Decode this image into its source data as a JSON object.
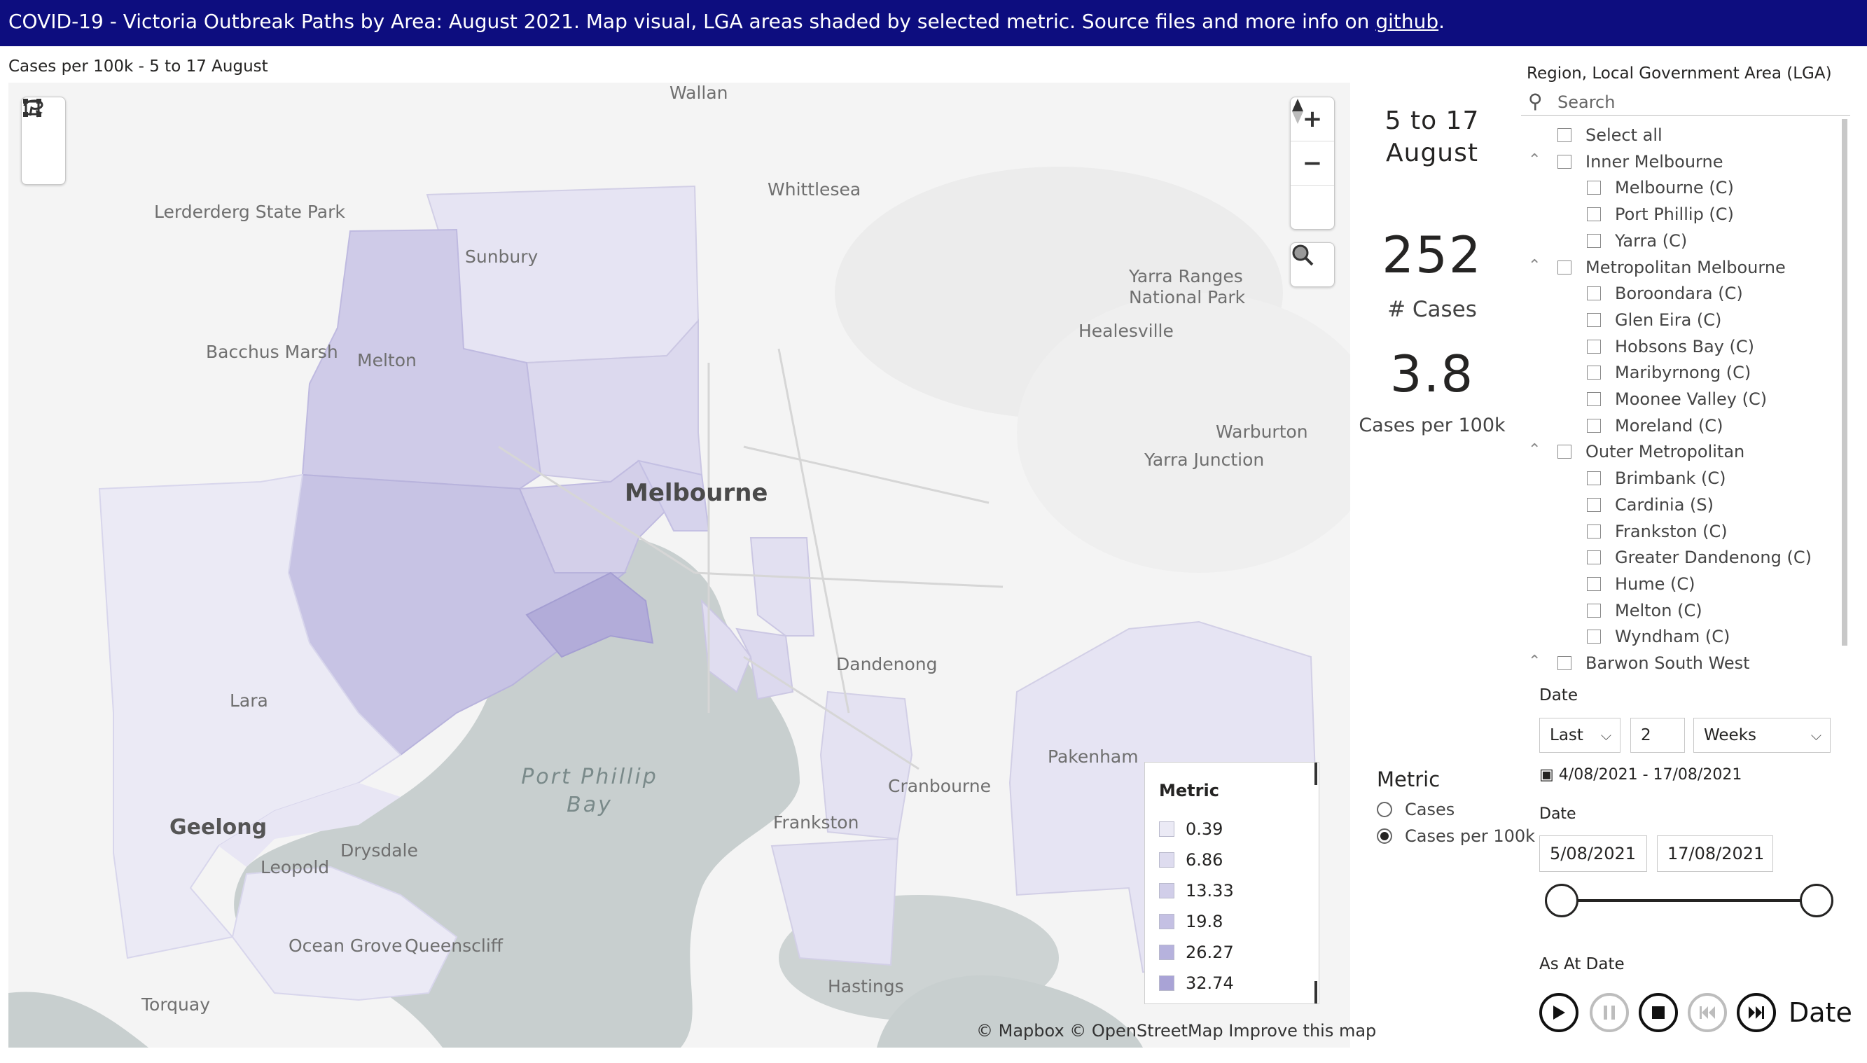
{
  "header": {
    "title_prefix": "COVID-19  - Victoria Outbreak Paths by Area: August 2021.  Map visual, LGA areas shaded by selected metric. Source files and more info on ",
    "title_link": "github",
    "title_suffix": "."
  },
  "map": {
    "title": "Cases per 100k - 5 to 17 August",
    "places": {
      "wallan": "Wallan",
      "whittlesea": "Whittlesea",
      "lerderderg": "Lerderderg State Park",
      "sunbury": "Sunbury",
      "yarra_ranges": "Yarra Ranges",
      "national_park": "National Park",
      "healesville": "Healesville",
      "bacchus": "Bacchus Marsh",
      "melton": "Melton",
      "warburton": "Warburton",
      "yarra_junction": "Yarra Junction",
      "melbourne": "Melbourne",
      "dandenong": "Dandenong",
      "lara": "Lara",
      "pakenham": "Pakenham",
      "port_phillip_1": "Port Phillip",
      "port_phillip_2": "Bay",
      "cranbourne": "Cranbourne",
      "frankston": "Frankston",
      "geelong": "Geelong",
      "drysdale": "Drysdale",
      "leopold": "Leopold",
      "ocean_grove": "Ocean Grove",
      "queenscliff": "Queenscliff",
      "hastings": "Hastings",
      "torquay": "Torquay"
    },
    "controls": {
      "zoom_in": "+",
      "zoom_out": "−"
    },
    "attribution": "© Mapbox © OpenStreetMap Improve this map",
    "logo": "mapbox",
    "shading_color": "#6a5acd",
    "legend": {
      "title": "Metric",
      "items": [
        {
          "label": "0.39",
          "color": "#ebeaf5"
        },
        {
          "label": "6.86",
          "color": "#dedcef"
        },
        {
          "label": "13.33",
          "color": "#d1cee9"
        },
        {
          "label": "19.8",
          "color": "#c4c0e3"
        },
        {
          "label": "26.27",
          "color": "#b6b2dd"
        },
        {
          "label": "32.74",
          "color": "#a9a3d6"
        }
      ]
    }
  },
  "kpi": {
    "period": "5 to 17 August",
    "cases_value": "252",
    "cases_label": "# Cases",
    "per100k_value": "3.8",
    "per100k_label": "Cases per 100k"
  },
  "slicer": {
    "title": "Region, Local Government Area (LGA)",
    "search_placeholder": "Search",
    "select_all": "Select all",
    "groups": [
      {
        "name": "Inner Melbourne",
        "items": [
          "Melbourne (C)",
          "Port Phillip (C)",
          "Yarra (C)"
        ]
      },
      {
        "name": "Metropolitan Melbourne",
        "items": [
          "Boroondara (C)",
          "Glen Eira (C)",
          "Hobsons Bay (C)",
          "Maribyrnong (C)",
          "Moonee Valley (C)",
          "Moreland (C)"
        ]
      },
      {
        "name": "Outer Metropolitan",
        "items": [
          "Brimbank (C)",
          "Cardinia (S)",
          "Frankston (C)",
          "Greater Dandenong (C)",
          "Hume (C)",
          "Melton (C)",
          "Wyndham (C)"
        ]
      },
      {
        "name": "Barwon South West",
        "items": []
      }
    ]
  },
  "date_filter": {
    "title": "Date",
    "mode": "Last",
    "count": "2",
    "unit": "Weeks",
    "range": "4/08/2021 - 17/08/2021"
  },
  "metric": {
    "title": "Metric",
    "options": [
      "Cases",
      "Cases per 100k"
    ],
    "selected": "Cases per 100k"
  },
  "date_range": {
    "title": "Date",
    "start": "5/08/2021",
    "end": "17/08/2021",
    "start_fraction": 0.0,
    "end_fraction": 1.0
  },
  "as_at": {
    "title": "As At Date",
    "date_button": "Date"
  }
}
